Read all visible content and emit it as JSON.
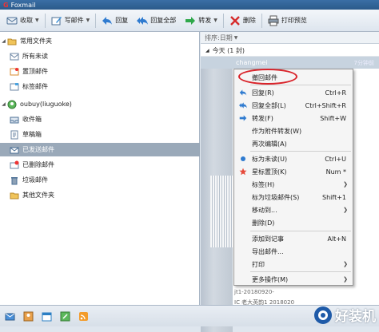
{
  "window": {
    "title": "Foxmail"
  },
  "toolbar": {
    "buttons": [
      {
        "label": "收取",
        "icon": "receive-icon",
        "dropdown": true
      },
      {
        "label": "写邮件",
        "icon": "compose-icon",
        "dropdown": true
      },
      {
        "label": "回复",
        "icon": "reply-icon",
        "dropdown": false
      },
      {
        "label": "回复全部",
        "icon": "reply-all-icon",
        "dropdown": false
      },
      {
        "label": "转发",
        "icon": "forward-icon",
        "dropdown": true
      },
      {
        "label": "删除",
        "icon": "delete-icon",
        "dropdown": false
      },
      {
        "label": "打印预览",
        "icon": "print-preview-icon",
        "dropdown": false
      }
    ]
  },
  "sidebar": {
    "groups": [
      {
        "label": "常用文件夹",
        "items": [
          "所有未读",
          "置顶邮件",
          "标签邮件"
        ]
      },
      {
        "label": "oubuy(liuguoke)",
        "items": [
          "收件箱",
          "草稿箱",
          "已发送邮件",
          "已删除邮件",
          "垃圾邮件",
          "其他文件夹"
        ],
        "selected": "已发送邮件"
      }
    ]
  },
  "list": {
    "sort_label": "排序:日期",
    "group_label": "今天 (1 封)",
    "row": {
      "sender": "changmei",
      "time": "7分钟前"
    },
    "footer_subject": "jt1-20180920-",
    "footer_sub": "IC 老大英韵1 2018020"
  },
  "context_menu": {
    "items": [
      {
        "label": "撤回邮件",
        "shortcut": "",
        "submenu": false,
        "icon": ""
      },
      {
        "label": "回复(R)",
        "shortcut": "Ctrl+R",
        "submenu": false,
        "icon": "reply-icon"
      },
      {
        "label": "回复全部(L)",
        "shortcut": "Ctrl+Shift+R",
        "submenu": false,
        "icon": "reply-all-icon"
      },
      {
        "label": "转发(F)",
        "shortcut": "Shift+W",
        "submenu": false,
        "icon": "forward-icon"
      },
      {
        "label": "作为附件转发(W)",
        "shortcut": "",
        "submenu": false,
        "icon": ""
      },
      {
        "label": "再次编辑(A)",
        "shortcut": "",
        "submenu": false,
        "icon": ""
      },
      {
        "label": "标为未读(U)",
        "shortcut": "Ctrl+U",
        "submenu": false,
        "icon": "unread-dot-icon"
      },
      {
        "label": "星标置顶(K)",
        "shortcut": "Num *",
        "submenu": false,
        "icon": "star-icon"
      },
      {
        "label": "标签(H)",
        "shortcut": "",
        "submenu": true,
        "icon": ""
      },
      {
        "label": "标为垃圾邮件(S)",
        "shortcut": "Shift+1",
        "submenu": false,
        "icon": ""
      },
      {
        "label": "移动到...",
        "shortcut": "",
        "submenu": true,
        "icon": ""
      },
      {
        "label": "删除(D)",
        "shortcut": "",
        "submenu": false,
        "icon": ""
      },
      {
        "label": "添加到记事",
        "shortcut": "Alt+N",
        "submenu": false,
        "icon": ""
      },
      {
        "label": "导出邮件...",
        "shortcut": "",
        "submenu": false,
        "icon": ""
      },
      {
        "label": "打印",
        "shortcut": "",
        "submenu": true,
        "icon": ""
      },
      {
        "label": "更多操作(M)",
        "shortcut": "",
        "submenu": true,
        "icon": ""
      }
    ],
    "highlight_color": "#d9232a"
  },
  "watermark": {
    "text": "好装机"
  },
  "colors": {
    "accent": "#3a6ea5",
    "selected_row": "#9aa9b9"
  }
}
